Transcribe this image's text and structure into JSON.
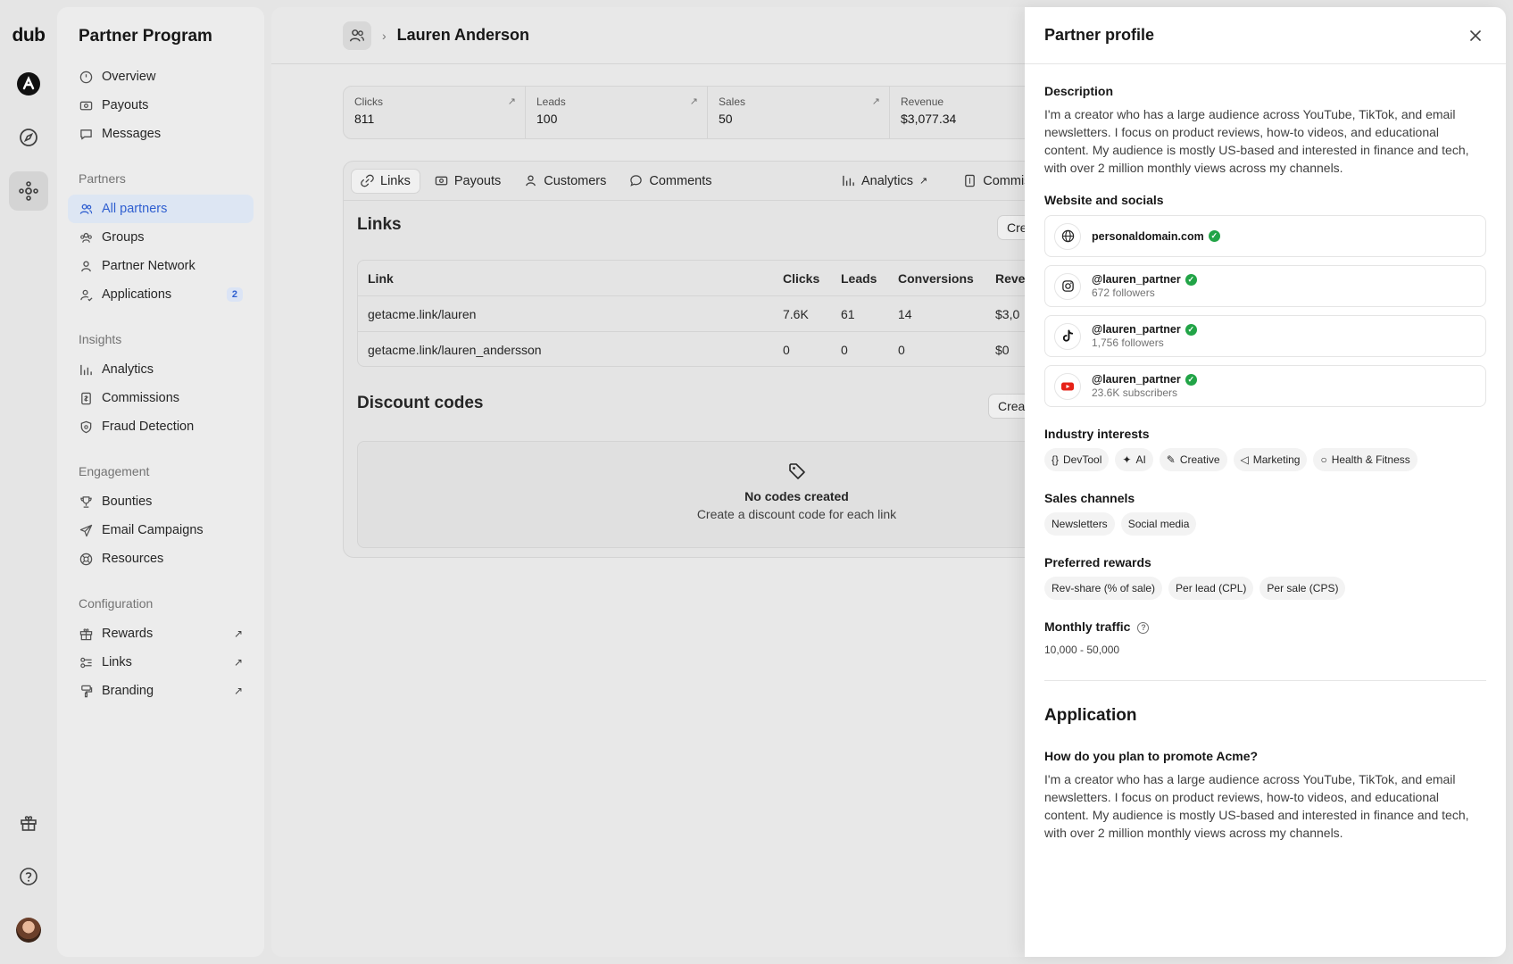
{
  "rail": {
    "logo": "dub"
  },
  "sidebar": {
    "title": "Partner Program",
    "top_items": [
      {
        "label": "Overview"
      },
      {
        "label": "Payouts"
      },
      {
        "label": "Messages"
      }
    ],
    "partners": {
      "title": "Partners",
      "items": [
        {
          "label": "All partners"
        },
        {
          "label": "Groups"
        },
        {
          "label": "Partner Network"
        },
        {
          "label": "Applications",
          "badge": "2"
        }
      ]
    },
    "insights": {
      "title": "Insights",
      "items": [
        {
          "label": "Analytics"
        },
        {
          "label": "Commissions"
        },
        {
          "label": "Fraud Detection"
        }
      ]
    },
    "engagement": {
      "title": "Engagement",
      "items": [
        {
          "label": "Bounties"
        },
        {
          "label": "Email Campaigns"
        },
        {
          "label": "Resources"
        }
      ]
    },
    "configuration": {
      "title": "Configuration",
      "items": [
        {
          "label": "Rewards"
        },
        {
          "label": "Links"
        },
        {
          "label": "Branding"
        }
      ]
    }
  },
  "header": {
    "title": "Lauren Anderson"
  },
  "stats": [
    {
      "label": "Clicks",
      "value": "811"
    },
    {
      "label": "Leads",
      "value": "100"
    },
    {
      "label": "Sales",
      "value": "50"
    },
    {
      "label": "Revenue",
      "value": "$3,077.34"
    }
  ],
  "tabs": {
    "links": "Links",
    "payouts": "Payouts",
    "customers": "Customers",
    "comments": "Comments",
    "analytics": "Analytics",
    "commissions": "Commis"
  },
  "links_section": {
    "title": "Links",
    "create_label": "Cre",
    "columns": [
      "Link",
      "Clicks",
      "Leads",
      "Conversions",
      "Reve"
    ],
    "rows": [
      {
        "link": "getacme.link/lauren",
        "clicks": "7.6K",
        "leads": "61",
        "conversions": "14",
        "revenue": "$3,0"
      },
      {
        "link": "getacme.link/lauren_andersson",
        "clicks": "0",
        "leads": "0",
        "conversions": "0",
        "revenue": "$0"
      }
    ]
  },
  "discount_section": {
    "title": "Discount codes",
    "create_label": "Creat",
    "empty_title": "No codes created",
    "empty_text": "Create a discount code for each link"
  },
  "panel": {
    "title": "Partner profile",
    "description_title": "Description",
    "description": "I'm a creator who has a large audience across YouTube, TikTok, and email newsletters. I focus on product reviews, how-to videos, and educational content. My audience is mostly US-based and interested in finance and tech, with over 2 million monthly views across my channels.",
    "socials_title": "Website and socials",
    "website": "personaldomain.com",
    "socials": [
      {
        "handle": "@lauren_partner",
        "sub": "672 followers",
        "icon": "instagram-icon"
      },
      {
        "handle": "@lauren_partner",
        "sub": "1,756 followers",
        "icon": "tiktok-icon"
      },
      {
        "handle": "@lauren_partner",
        "sub": "23.6K subscribers",
        "icon": "youtube-icon"
      }
    ],
    "interests_title": "Industry interests",
    "interests": [
      "DevTool",
      "AI",
      "Creative",
      "Marketing",
      "Health & Fitness"
    ],
    "channels_title": "Sales channels",
    "channels": [
      "Newsletters",
      "Social media"
    ],
    "rewards_title": "Preferred rewards",
    "rewards": [
      "Rev-share (% of sale)",
      "Per lead (CPL)",
      "Per sale (CPS)"
    ],
    "traffic_title": "Monthly traffic",
    "traffic": "10,000 - 50,000",
    "application_title": "Application",
    "question": "How do you plan to promote Acme?",
    "answer": "I'm a creator who has a large audience across YouTube, TikTok, and email newsletters. I focus on product reviews, how-to videos, and educational content. My audience is mostly US-based and interested in finance and tech, with over 2 million monthly views across my channels."
  }
}
